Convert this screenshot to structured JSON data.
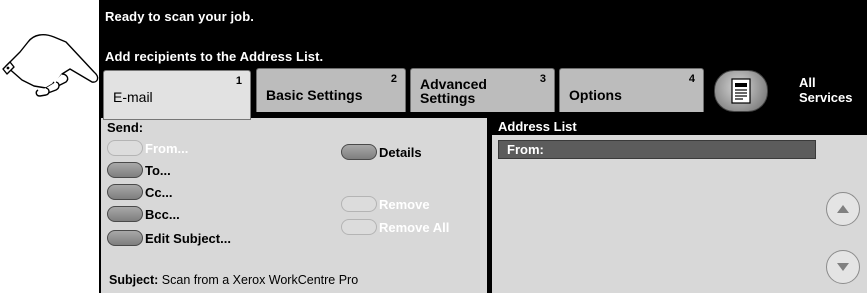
{
  "status": {
    "line1": "Ready to scan your job.",
    "line2": "Add recipients to the Address List."
  },
  "tabs": [
    {
      "label": "E-mail",
      "number": "1"
    },
    {
      "label": "Basic Settings",
      "number": "2"
    },
    {
      "label": "Advanced\nSettings",
      "number": "3"
    },
    {
      "label": "Options",
      "number": "4"
    }
  ],
  "all_services": {
    "label": "All\nServices",
    "icon": "all-services-icon"
  },
  "send": {
    "heading": "Send:",
    "from": "From...",
    "to": "To...",
    "cc": "Cc...",
    "bcc": "Bcc...",
    "edit_subject": "Edit Subject...",
    "details": "Details",
    "remove": "Remove",
    "remove_all": "Remove All",
    "subject_label": "Subject:",
    "subject_value": "Scan from a Xerox WorkCentre Pro"
  },
  "address_list": {
    "title": "Address List",
    "from_label": "From:"
  },
  "colors": {
    "screen_bg": "#000000",
    "panel_bg": "#d8d8d8",
    "tab_bg": "#bcbcbc",
    "selected_row": "#5c5c5c"
  }
}
